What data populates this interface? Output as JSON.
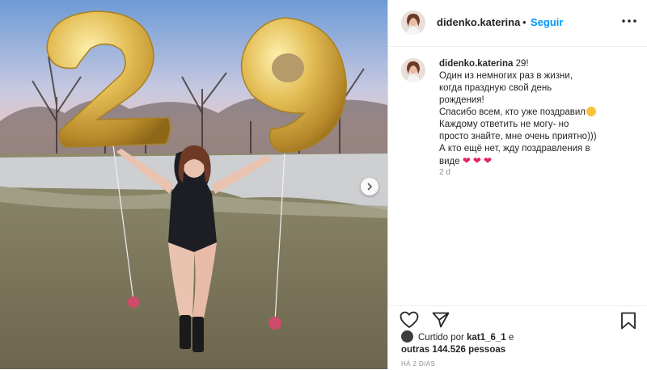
{
  "post": {
    "username": "didenko.katerina",
    "separator": "•",
    "follow_label": "Seguir",
    "caption_lines": [
      "Один из немногих раз в жизни,",
      "когда праздную свой день",
      "рождения!",
      "Спасибо всем, кто уже поздравил",
      "Каждому ответить не могу- но",
      "просто знайте, мне очень приятно)))",
      "А кто ещё нет, жду поздравления в",
      "виде"
    ],
    "caption_first": "29!",
    "relative_time": "2 d",
    "liked_prefix": "Curtido por",
    "liked_user": "kat1_6_1",
    "liked_and": "e",
    "liked_others": "outras 144.526 pessoas",
    "post_date": "HÁ 2 DIAS"
  },
  "icons": {
    "more": "more-horizontal-icon",
    "like": "heart-outline-icon",
    "share": "send-icon",
    "save": "bookmark-icon",
    "next": "chevron-right-icon"
  },
  "colors": {
    "follow": "#0095f6",
    "text": "#262626",
    "muted": "#8e8e8e",
    "heart_emoji": "#e0245e",
    "balloon_gold": "#d4a93c"
  }
}
